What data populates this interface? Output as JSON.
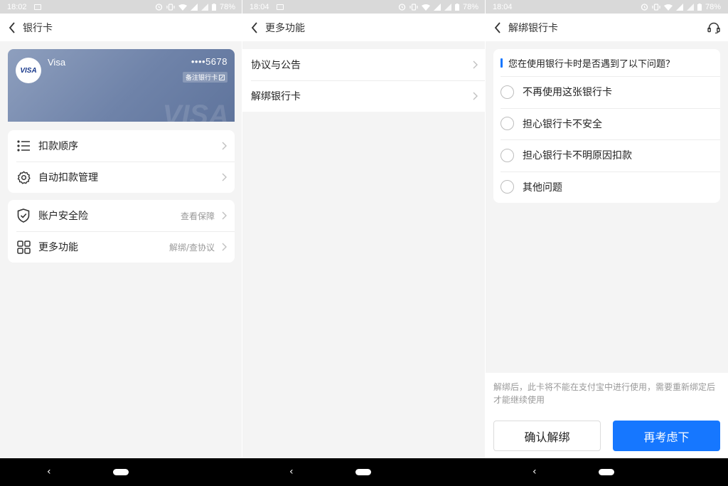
{
  "screens": [
    {
      "status": {
        "time": "18:02",
        "battery": "78%"
      },
      "header": {
        "title": "银行卡"
      },
      "card": {
        "brand_logo": "VISA",
        "name": "Visa",
        "number": "••••5678",
        "remark": "备注银行卡",
        "watermark": "VISA"
      },
      "group1": [
        {
          "icon": "list-icon",
          "label": "扣款顺序"
        },
        {
          "icon": "gear-icon",
          "label": "自动扣款管理"
        }
      ],
      "group2": [
        {
          "icon": "shield-icon",
          "label": "账户安全险",
          "sub": "查看保障"
        },
        {
          "icon": "grid-icon",
          "label": "更多功能",
          "sub": "解绑/查协议"
        }
      ]
    },
    {
      "status": {
        "time": "18:04",
        "battery": "78%"
      },
      "header": {
        "title": "更多功能"
      },
      "items": [
        {
          "label": "协议与公告"
        },
        {
          "label": "解绑银行卡"
        }
      ]
    },
    {
      "status": {
        "time": "18:04",
        "battery": "78%"
      },
      "header": {
        "title": "解绑银行卡"
      },
      "question": "您在使用银行卡时是否遇到了以下问题？",
      "options": [
        {
          "label": "不再使用这张银行卡"
        },
        {
          "label": "担心银行卡不安全"
        },
        {
          "label": "担心银行卡不明原因扣款"
        },
        {
          "label": "其他问题"
        }
      ],
      "notice": "解绑后，此卡将不能在支付宝中进行使用，需要重新绑定后才能继续使用",
      "buttons": {
        "confirm": "确认解绑",
        "reconsider": "再考虑下"
      }
    }
  ],
  "nav": {
    "back_glyph": "‹"
  },
  "colors": {
    "accent": "#1677ff",
    "card_gradient_start": "#8e9fbe",
    "card_gradient_end": "#5f749c",
    "background": "#f4f4f4"
  }
}
